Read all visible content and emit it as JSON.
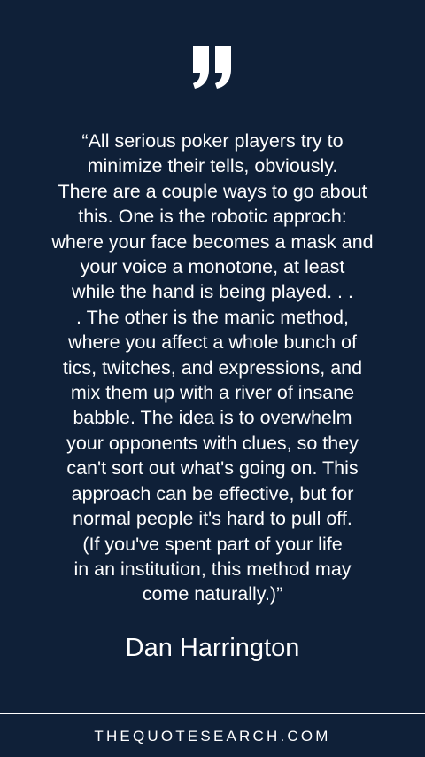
{
  "quote_icon": "closing-double-quote-icon",
  "quote": {
    "text": "“All serious poker players try to\nminimize their tells, obviously.\nThere are a couple ways to go about\nthis. One is the robotic approch:\nwhere your face becomes a mask and\nyour voice a monotone, at least\nwhile the hand is being played. . .\n. The other is the manic method,\nwhere you affect a whole bunch of\ntics, twitches, and expressions, and\nmix them up with a river of insane\nbabble. The idea is to overwhelm\nyour opponents with clues, so they\ncan't sort out what's going on. This\napproach can be effective, but for\nnormal people it's hard to pull off.\n(If you've spent part of your life\nin an institution, this method may\ncome naturally.)”"
  },
  "author": "Dan Harrington",
  "footer": {
    "site": "THEQUOTESEARCH.COM"
  },
  "colors": {
    "background": "#0f2038",
    "text": "#ffffff"
  }
}
